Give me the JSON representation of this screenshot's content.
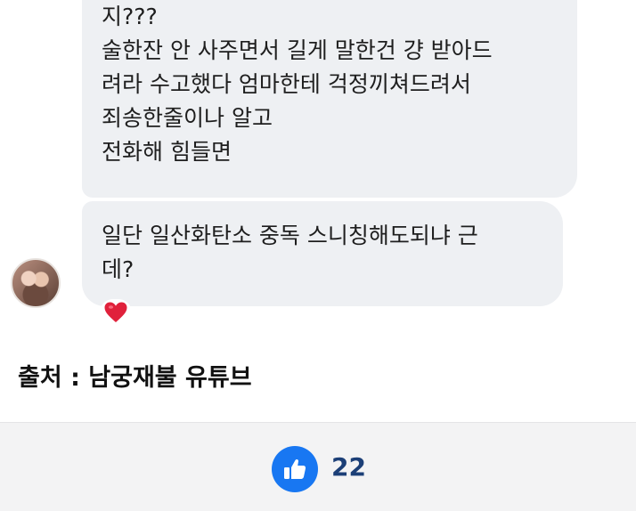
{
  "chat": {
    "messages": [
      {
        "lines": [
          "지???",
          "술한잔 안 사주면서 길게 말한건 걍 받아드",
          "려라 수고했다 엄마한테 걱정끼쳐드려서",
          "죄송한줄이나 알고",
          "전화해 힘들면"
        ]
      },
      {
        "lines": [
          "일단 일산화탄소 중독 스니칭해도되냐 근",
          "데?"
        ],
        "reaction": "heart-icon"
      }
    ]
  },
  "source": {
    "text": "출처 : 남궁재불 유튜브"
  },
  "footer": {
    "like_icon": "thumbs-up-icon",
    "like_count": "22",
    "accent_color": "#1877f2"
  }
}
